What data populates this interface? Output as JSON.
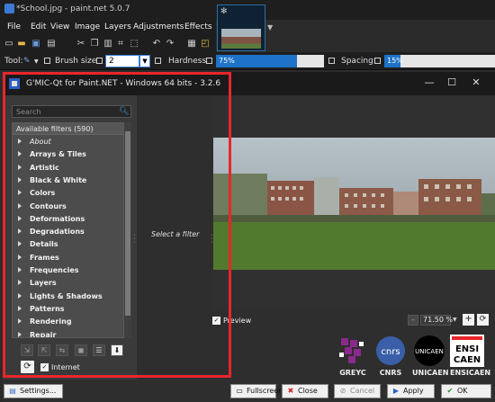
{
  "paintnet": {
    "title": "*School.jpg - paint.net 5.0.7",
    "menu": [
      "File",
      "Edit",
      "View",
      "Image",
      "Layers",
      "Adjustments",
      "Effects"
    ],
    "tools": {
      "tool_label": "Tool:",
      "brush_size_label": "Brush size:",
      "brush_size_value": "2",
      "hardness_label": "Hardness:",
      "hardness_value": "75%",
      "hardness_fraction": 0.75,
      "spacing_label": "Spacing:",
      "spacing_value": "15%",
      "spacing_fraction": 0.15
    }
  },
  "gmic": {
    "title": "G'MIC-Qt for Paint.NET - Windows 64 bits - 3.2.6",
    "search_placeholder": "Search",
    "filters_header": "Available filters (590)",
    "categories": [
      {
        "label": "About",
        "italic": true
      },
      {
        "label": "Arrays & Tiles"
      },
      {
        "label": "Artistic"
      },
      {
        "label": "Black & White"
      },
      {
        "label": "Colors"
      },
      {
        "label": "Contours"
      },
      {
        "label": "Deformations"
      },
      {
        "label": "Degradations"
      },
      {
        "label": "Details"
      },
      {
        "label": "Frames"
      },
      {
        "label": "Frequencies"
      },
      {
        "label": "Layers"
      },
      {
        "label": "Lights & Shadows"
      },
      {
        "label": "Patterns"
      },
      {
        "label": "Rendering"
      },
      {
        "label": "Repair"
      }
    ],
    "select_filter": "Select a filter",
    "internet_label": "Internet",
    "preview_label": "Preview",
    "zoom_value": "71.50 %",
    "logos": [
      "GREYC",
      "CNRS",
      "UNICAEN",
      "ENSICAEN"
    ],
    "buttons": {
      "settings": "Settings...",
      "fullscreen": "Fullscreen",
      "close": "Close",
      "cancel": "Cancel",
      "apply": "Apply",
      "ok": "OK"
    }
  },
  "colors": {
    "highlight": "#e8262b",
    "accent": "#1e73c8"
  }
}
